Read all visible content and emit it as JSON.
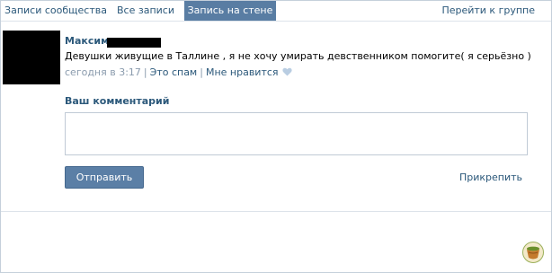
{
  "tabs": [
    {
      "label": "Записи сообщества"
    },
    {
      "label": "Все записи"
    },
    {
      "label": "Запись на стене"
    }
  ],
  "tabs_right": {
    "label": "Перейти к группе"
  },
  "post": {
    "author": "Максим",
    "text": "Девушки живущие в Таллине , я не хочу умирать девственником помогите( я серьёзно )",
    "time": "сегодня в 3:17",
    "spam_label": "Это спам",
    "like_label": "Мне нравится",
    "separator": "|"
  },
  "comment": {
    "label": "Ваш комментарий",
    "placeholder": "",
    "send_label": "Отправить",
    "attach_label": "Прикрепить"
  },
  "colors": {
    "accent": "#597da3",
    "link": "#2b587a",
    "muted": "#8a9bad"
  }
}
